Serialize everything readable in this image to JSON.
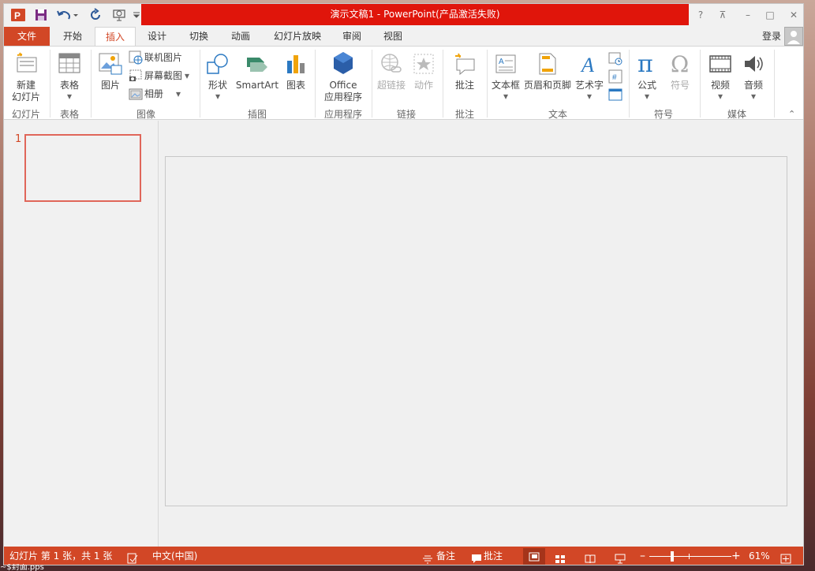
{
  "titlebar": {
    "title": "演示文稿1 -  PowerPoint(产品激活失败)",
    "controls": {
      "help": "?",
      "ribbon_display": "⊼",
      "minimize": "–",
      "maximize": "□",
      "close": "✕"
    }
  },
  "tabs": {
    "file": "文件",
    "items": [
      "开始",
      "插入",
      "设计",
      "切换",
      "动画",
      "幻灯片放映",
      "审阅",
      "视图"
    ],
    "active": "插入",
    "login": "登录"
  },
  "ribbon": {
    "new_slide": {
      "line1": "新建",
      "line2": "幻灯片"
    },
    "table": "表格",
    "picture": "图片",
    "online_picture": "联机图片",
    "screenshot": "屏幕截图",
    "album": "相册",
    "shapes": "形状",
    "smartart": "SmartArt",
    "chart": "图表",
    "office_apps": {
      "line1": "Office",
      "line2": "应用程序"
    },
    "hyperlink": "超链接",
    "action": "动作",
    "comment": "批注",
    "textbox": "文本框",
    "header_footer": "页眉和页脚",
    "wordart": "艺术字",
    "equation": "公式",
    "symbol": "符号",
    "video": "视频",
    "audio": "音频",
    "groups": {
      "slides": "幻灯片",
      "tables": "表格",
      "images": "图像",
      "illustrations": "插图",
      "apps": "应用程序",
      "links": "链接",
      "comments": "批注",
      "text": "文本",
      "symbols": "符号",
      "media": "媒体"
    }
  },
  "thumbnails": {
    "number": "1"
  },
  "status": {
    "slide_info": "幻灯片 第 1 张，共 1 张",
    "language": "中文(中国)",
    "notes": "备注",
    "comments": "批注",
    "zoom": "61%"
  },
  "taskbar": {
    "hint": "~$封面.pps"
  },
  "colors": {
    "accent": "#d24726",
    "title_red": "#e0150b"
  }
}
